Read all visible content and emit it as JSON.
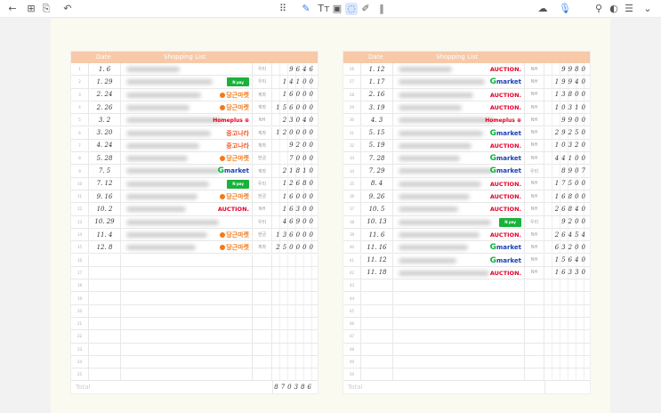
{
  "toolbar": {
    "left": [
      "back-arrow-icon",
      "grid-view-icon",
      "export-page-icon",
      "undo-icon"
    ],
    "center": [
      "apps-icon",
      "pen-icon",
      "text-icon",
      "image-icon",
      "lasso-icon",
      "highlighter-icon",
      "more-icon"
    ],
    "right": [
      "cloud-sync-icon",
      "microphone-icon",
      "search-icon",
      "toggle-icon",
      "list-icon",
      "chevron-down-icon"
    ]
  },
  "headers": {
    "date": "Date",
    "list": "Shopping List"
  },
  "total_label": "Total",
  "logos": {
    "npay": "N pay",
    "daangn": "당근마켓",
    "homeplus": "Homeplus ⊕",
    "joongna": "중고나라",
    "gmarket_g": "G",
    "gmarket": "market",
    "auction": "AUCTION."
  },
  "sheets": [
    {
      "start": 1,
      "total": "870386",
      "rows": [
        {
          "date": "1. 6",
          "store": "",
          "pay": "우리",
          "amount": "9646"
        },
        {
          "date": "1. 29",
          "store": "npay",
          "pay": "우리",
          "amount": "14100"
        },
        {
          "date": "2. 24",
          "store": "daangn",
          "pay": "계좌",
          "amount": "16000"
        },
        {
          "date": "2. 26",
          "store": "daangn",
          "pay": "계좌",
          "amount": "156000"
        },
        {
          "date": "3. 2",
          "store": "homeplus",
          "pay": "NH",
          "amount": "23040"
        },
        {
          "date": "3. 20",
          "store": "joongna",
          "pay": "계좌",
          "amount": "120000"
        },
        {
          "date": "4. 24",
          "store": "joongna",
          "pay": "계좌",
          "amount": "9200"
        },
        {
          "date": "5. 28",
          "store": "daangn",
          "pay": "현금",
          "amount": "7000"
        },
        {
          "date": "7. 5",
          "store": "gmarket",
          "pay": "계좌",
          "amount": "21810"
        },
        {
          "date": "7. 12",
          "store": "npay",
          "pay": "우리",
          "amount": "12680"
        },
        {
          "date": "9. 16",
          "store": "daangn",
          "pay": "현금",
          "amount": "16000"
        },
        {
          "date": "10. 2",
          "store": "auction",
          "pay": "NH",
          "amount": "16300"
        },
        {
          "date": "10. 29",
          "store": "",
          "pay": "우리",
          "amount": "46900"
        },
        {
          "date": "11. 4",
          "store": "daangn",
          "pay": "현금",
          "amount": "136000"
        },
        {
          "date": "12. 8",
          "store": "daangn",
          "pay": "계좌",
          "amount": "250000"
        }
      ]
    },
    {
      "start": 26,
      "total": "",
      "rows": [
        {
          "date": "1. 12",
          "store": "auction",
          "pay": "NH",
          "amount": "9980"
        },
        {
          "date": "1. 17",
          "store": "gmarket",
          "pay": "NH",
          "amount": "19940"
        },
        {
          "date": "2. 16",
          "store": "auction",
          "pay": "NH",
          "amount": "13800"
        },
        {
          "date": "3. 19",
          "store": "auction",
          "pay": "NH",
          "amount": "10310"
        },
        {
          "date": "4. 3",
          "store": "homeplus",
          "pay": "NH",
          "amount": "9900"
        },
        {
          "date": "5. 15",
          "store": "gmarket",
          "pay": "NH",
          "amount": "29250"
        },
        {
          "date": "5. 19",
          "store": "auction",
          "pay": "NH",
          "amount": "10320"
        },
        {
          "date": "7. 28",
          "store": "gmarket",
          "pay": "NH",
          "amount": "44100"
        },
        {
          "date": "7. 29",
          "store": "gmarket",
          "pay": "우리",
          "amount": "8907"
        },
        {
          "date": "8. 4",
          "store": "auction",
          "pay": "NH",
          "amount": "17500"
        },
        {
          "date": "9. 26",
          "store": "auction",
          "pay": "NH",
          "amount": "16800"
        },
        {
          "date": "10. 5",
          "store": "auction",
          "pay": "NH",
          "amount": "26840"
        },
        {
          "date": "10. 13",
          "store": "npay",
          "pay": "우리",
          "amount": "9200"
        },
        {
          "date": "11. 6",
          "store": "auction",
          "pay": "NH",
          "amount": "26454"
        },
        {
          "date": "11. 16",
          "store": "gmarket",
          "pay": "NH",
          "amount": "63200"
        },
        {
          "date": "11. 12",
          "store": "gmarket",
          "pay": "NH",
          "amount": "15640"
        },
        {
          "date": "11. 18",
          "store": "auction",
          "pay": "NH",
          "amount": "16330"
        }
      ]
    }
  ]
}
